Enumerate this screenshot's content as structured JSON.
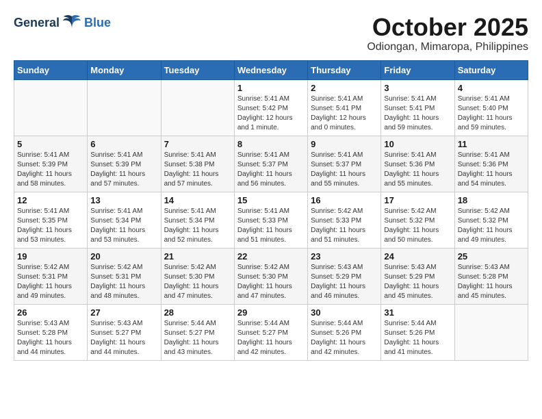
{
  "logo": {
    "general": "General",
    "blue": "Blue"
  },
  "title": "October 2025",
  "subtitle": "Odiongan, Mimaropa, Philippines",
  "days_of_week": [
    "Sunday",
    "Monday",
    "Tuesday",
    "Wednesday",
    "Thursday",
    "Friday",
    "Saturday"
  ],
  "weeks": [
    [
      {
        "day": "",
        "info": ""
      },
      {
        "day": "",
        "info": ""
      },
      {
        "day": "",
        "info": ""
      },
      {
        "day": "1",
        "info": "Sunrise: 5:41 AM\nSunset: 5:42 PM\nDaylight: 12 hours\nand 1 minute."
      },
      {
        "day": "2",
        "info": "Sunrise: 5:41 AM\nSunset: 5:41 PM\nDaylight: 12 hours\nand 0 minutes."
      },
      {
        "day": "3",
        "info": "Sunrise: 5:41 AM\nSunset: 5:41 PM\nDaylight: 11 hours\nand 59 minutes."
      },
      {
        "day": "4",
        "info": "Sunrise: 5:41 AM\nSunset: 5:40 PM\nDaylight: 11 hours\nand 59 minutes."
      }
    ],
    [
      {
        "day": "5",
        "info": "Sunrise: 5:41 AM\nSunset: 5:39 PM\nDaylight: 11 hours\nand 58 minutes."
      },
      {
        "day": "6",
        "info": "Sunrise: 5:41 AM\nSunset: 5:39 PM\nDaylight: 11 hours\nand 57 minutes."
      },
      {
        "day": "7",
        "info": "Sunrise: 5:41 AM\nSunset: 5:38 PM\nDaylight: 11 hours\nand 57 minutes."
      },
      {
        "day": "8",
        "info": "Sunrise: 5:41 AM\nSunset: 5:37 PM\nDaylight: 11 hours\nand 56 minutes."
      },
      {
        "day": "9",
        "info": "Sunrise: 5:41 AM\nSunset: 5:37 PM\nDaylight: 11 hours\nand 55 minutes."
      },
      {
        "day": "10",
        "info": "Sunrise: 5:41 AM\nSunset: 5:36 PM\nDaylight: 11 hours\nand 55 minutes."
      },
      {
        "day": "11",
        "info": "Sunrise: 5:41 AM\nSunset: 5:36 PM\nDaylight: 11 hours\nand 54 minutes."
      }
    ],
    [
      {
        "day": "12",
        "info": "Sunrise: 5:41 AM\nSunset: 5:35 PM\nDaylight: 11 hours\nand 53 minutes."
      },
      {
        "day": "13",
        "info": "Sunrise: 5:41 AM\nSunset: 5:34 PM\nDaylight: 11 hours\nand 53 minutes."
      },
      {
        "day": "14",
        "info": "Sunrise: 5:41 AM\nSunset: 5:34 PM\nDaylight: 11 hours\nand 52 minutes."
      },
      {
        "day": "15",
        "info": "Sunrise: 5:41 AM\nSunset: 5:33 PM\nDaylight: 11 hours\nand 51 minutes."
      },
      {
        "day": "16",
        "info": "Sunrise: 5:42 AM\nSunset: 5:33 PM\nDaylight: 11 hours\nand 51 minutes."
      },
      {
        "day": "17",
        "info": "Sunrise: 5:42 AM\nSunset: 5:32 PM\nDaylight: 11 hours\nand 50 minutes."
      },
      {
        "day": "18",
        "info": "Sunrise: 5:42 AM\nSunset: 5:32 PM\nDaylight: 11 hours\nand 49 minutes."
      }
    ],
    [
      {
        "day": "19",
        "info": "Sunrise: 5:42 AM\nSunset: 5:31 PM\nDaylight: 11 hours\nand 49 minutes."
      },
      {
        "day": "20",
        "info": "Sunrise: 5:42 AM\nSunset: 5:31 PM\nDaylight: 11 hours\nand 48 minutes."
      },
      {
        "day": "21",
        "info": "Sunrise: 5:42 AM\nSunset: 5:30 PM\nDaylight: 11 hours\nand 47 minutes."
      },
      {
        "day": "22",
        "info": "Sunrise: 5:42 AM\nSunset: 5:30 PM\nDaylight: 11 hours\nand 47 minutes."
      },
      {
        "day": "23",
        "info": "Sunrise: 5:43 AM\nSunset: 5:29 PM\nDaylight: 11 hours\nand 46 minutes."
      },
      {
        "day": "24",
        "info": "Sunrise: 5:43 AM\nSunset: 5:29 PM\nDaylight: 11 hours\nand 45 minutes."
      },
      {
        "day": "25",
        "info": "Sunrise: 5:43 AM\nSunset: 5:28 PM\nDaylight: 11 hours\nand 45 minutes."
      }
    ],
    [
      {
        "day": "26",
        "info": "Sunrise: 5:43 AM\nSunset: 5:28 PM\nDaylight: 11 hours\nand 44 minutes."
      },
      {
        "day": "27",
        "info": "Sunrise: 5:43 AM\nSunset: 5:27 PM\nDaylight: 11 hours\nand 44 minutes."
      },
      {
        "day": "28",
        "info": "Sunrise: 5:44 AM\nSunset: 5:27 PM\nDaylight: 11 hours\nand 43 minutes."
      },
      {
        "day": "29",
        "info": "Sunrise: 5:44 AM\nSunset: 5:27 PM\nDaylight: 11 hours\nand 42 minutes."
      },
      {
        "day": "30",
        "info": "Sunrise: 5:44 AM\nSunset: 5:26 PM\nDaylight: 11 hours\nand 42 minutes."
      },
      {
        "day": "31",
        "info": "Sunrise: 5:44 AM\nSunset: 5:26 PM\nDaylight: 11 hours\nand 41 minutes."
      },
      {
        "day": "",
        "info": ""
      }
    ]
  ]
}
